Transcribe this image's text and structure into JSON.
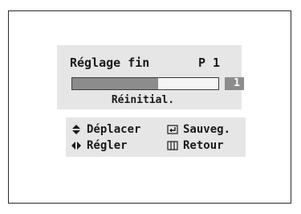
{
  "osd": {
    "title": "Réglage fin",
    "program": "P 1",
    "fine_tune": {
      "value": "1",
      "level_percent": 59
    },
    "reset_label": "Réinitial."
  },
  "help": {
    "move": {
      "icon": "up-down-arrows-icon",
      "label": "Déplacer"
    },
    "save": {
      "icon": "enter-icon",
      "label": "Sauveg."
    },
    "adjust": {
      "icon": "left-right-arrows-icon",
      "label": "Régler"
    },
    "back": {
      "icon": "return-icon",
      "label": "Retour"
    }
  },
  "colors": {
    "panel": "#e6e6e6",
    "bar_fill": "#8c8c8c",
    "text": "#1a1a1a"
  }
}
